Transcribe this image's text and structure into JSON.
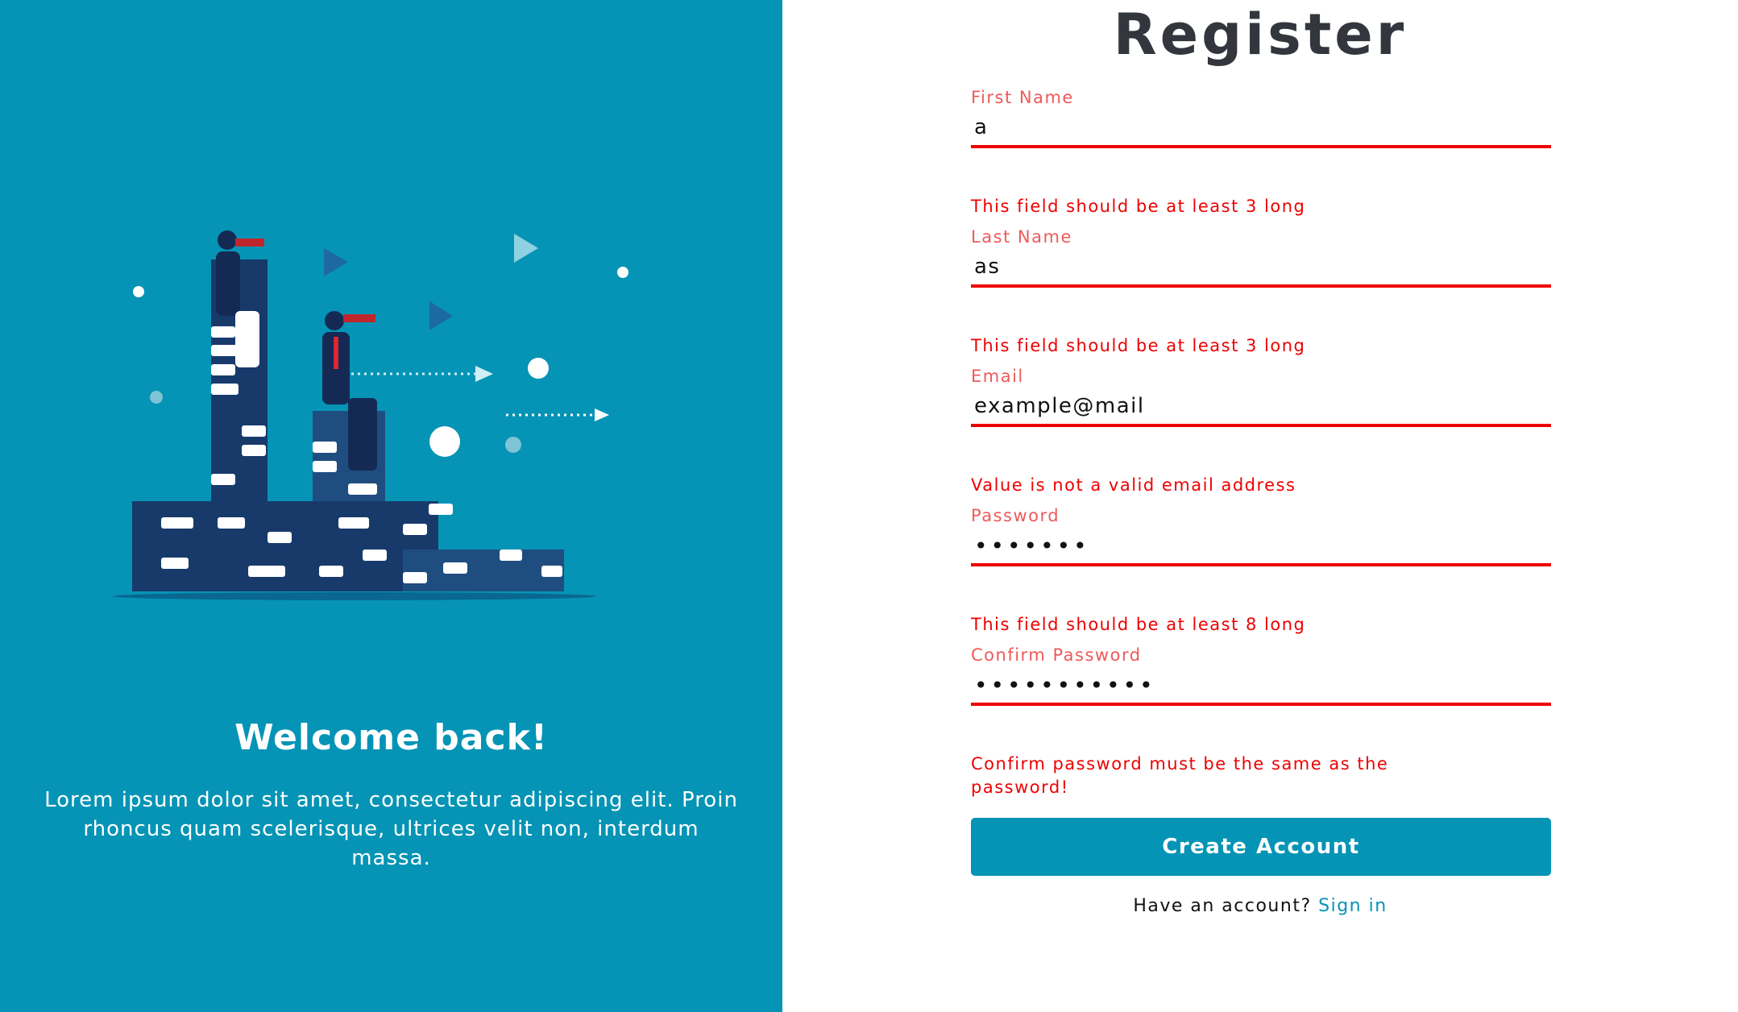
{
  "left": {
    "welcome_title": "Welcome back!",
    "welcome_text": "Lorem ipsum dolor sit amet, consectetur adipiscing elit. Proin rhoncus quam scelerisque, ultrices velit non, interdum massa.",
    "background_color": "#0594b5"
  },
  "form": {
    "title": "Register",
    "fields": [
      {
        "label": "First Name",
        "value": "a",
        "type": "text",
        "error": "This field should be at least 3 long"
      },
      {
        "label": "Last Name",
        "value": "as",
        "type": "text",
        "error": "This field should be at least 3 long"
      },
      {
        "label": "Email",
        "value": "example@mail",
        "type": "email",
        "error": "Value is not a valid email address"
      },
      {
        "label": "Password",
        "value": "•••••••",
        "type": "password",
        "error": "This field should be at least 8 long"
      },
      {
        "label": "Confirm Password",
        "value": "•••••••••••",
        "type": "password",
        "error": "Confirm password must be the same as the password!"
      }
    ],
    "submit_label": "Create Account",
    "signin_prompt": "Have an account?",
    "signin_link": "Sign in",
    "accent_color": "#0594b5",
    "error_color": "#ee0000"
  }
}
